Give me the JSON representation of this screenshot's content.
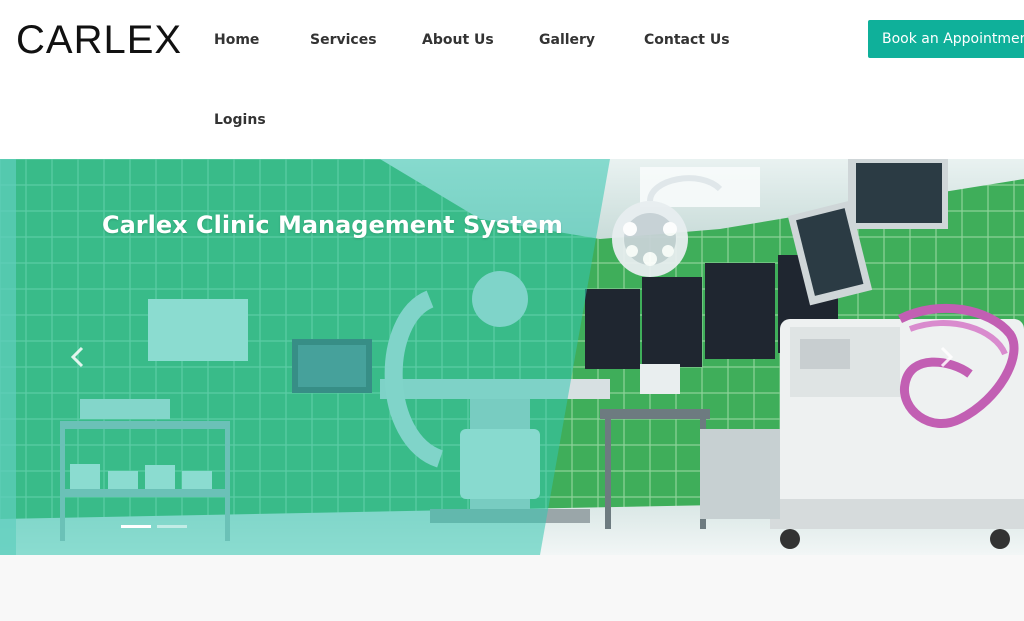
{
  "brand": {
    "logo_text": "CARLEX"
  },
  "nav": {
    "items": [
      {
        "label": "Home"
      },
      {
        "label": "Services"
      },
      {
        "label": "About Us"
      },
      {
        "label": "Gallery"
      },
      {
        "label": "Contact Us"
      },
      {
        "label": "Logins"
      }
    ],
    "cta_label": "Book an Appointment"
  },
  "hero": {
    "title": "Carlex Clinic Management System",
    "prev_icon": "chevron-left-icon",
    "next_icon": "chevron-right-icon",
    "slide_count": 2,
    "active_slide": 1
  },
  "colors": {
    "accent": "#0fb09a",
    "overlay": "#35c6b0",
    "tile_green": "#3fae5a",
    "nav_text": "#333333",
    "logo_text": "#111111",
    "page_bg": "#f8f8f8"
  }
}
